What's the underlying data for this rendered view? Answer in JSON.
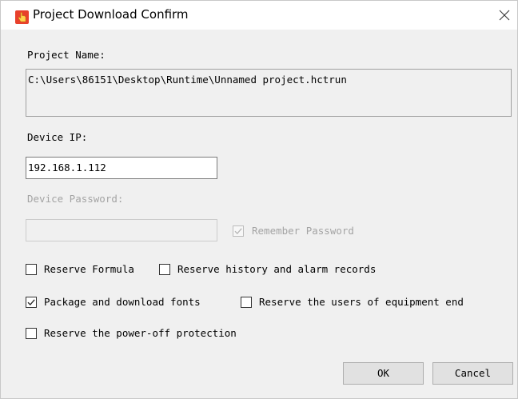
{
  "window": {
    "title": "Project Download Confirm"
  },
  "project_name": {
    "label": "Project Name:",
    "value": "C:\\Users\\86151\\Desktop\\Runtime\\Unnamed project.hctrun"
  },
  "device_ip": {
    "label": "Device IP:",
    "value": "192.168.1.112"
  },
  "device_password": {
    "label": "Device Password:",
    "value": "",
    "enabled": false
  },
  "remember_password": {
    "label": "Remember Password",
    "checked": true,
    "enabled": false
  },
  "options": {
    "reserve_formula": {
      "label": "Reserve Formula",
      "checked": false
    },
    "reserve_history": {
      "label": "Reserve history and alarm records",
      "checked": false
    },
    "package_fonts": {
      "label": "Package and download fonts",
      "checked": true
    },
    "reserve_users": {
      "label": "Reserve the users of equipment end",
      "checked": false
    },
    "reserve_power_off": {
      "label": "Reserve the power-off protection",
      "checked": false
    }
  },
  "buttons": {
    "ok": "OK",
    "cancel": "Cancel"
  },
  "icons": {
    "app": "hand-pointer-icon",
    "close": "close-icon",
    "check": "checkmark-icon"
  },
  "colors": {
    "dialog_bg": "#f0f0f0",
    "disabled_text": "#a4a4a4",
    "button_bg": "#e1e1e1"
  }
}
